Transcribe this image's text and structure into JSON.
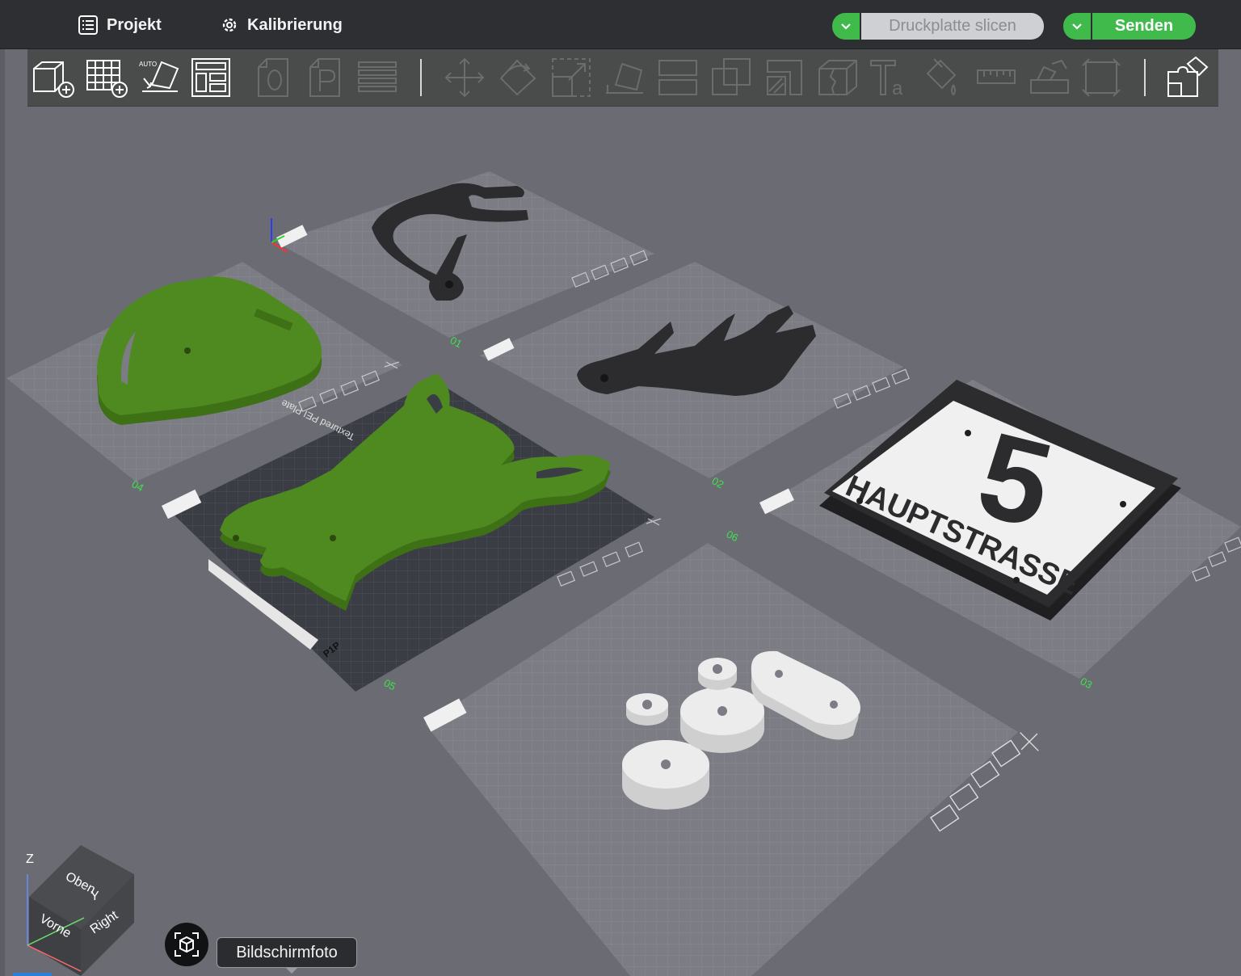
{
  "header": {
    "menu": [
      {
        "label": "Projekt",
        "icon": "list-icon"
      },
      {
        "label": "Kalibrierung",
        "icon": "gear-icon"
      }
    ],
    "slice_button": {
      "label": "Druckplatte slicen",
      "enabled": false
    },
    "send_button": {
      "label": "Senden",
      "enabled": true
    },
    "accent_color": "#3fba4b"
  },
  "toolbar": {
    "tools": [
      {
        "name": "add-part",
        "icon": "cube-plus-icon",
        "enabled": true
      },
      {
        "name": "add-plate",
        "icon": "grid-plus-icon",
        "enabled": true
      },
      {
        "name": "auto-orient",
        "icon": "auto-orient-icon",
        "enabled": true
      },
      {
        "name": "arrange",
        "icon": "arrange-layout-icon",
        "enabled": true
      },
      {
        "name": "orient-o",
        "icon": "o-page-icon",
        "enabled": false
      },
      {
        "name": "plate-p",
        "icon": "p-page-icon",
        "enabled": false
      },
      {
        "name": "layers",
        "icon": "layers-icon",
        "enabled": false
      },
      {
        "name": "move",
        "icon": "move-icon",
        "enabled": false
      },
      {
        "name": "rotate",
        "icon": "rotate-icon",
        "enabled": false
      },
      {
        "name": "scale",
        "icon": "scale-icon",
        "enabled": false
      },
      {
        "name": "lay-on-face",
        "icon": "lay-on-face-icon",
        "enabled": false
      },
      {
        "name": "cut",
        "icon": "cut-icon",
        "enabled": false
      },
      {
        "name": "boolean",
        "icon": "boolean-icon",
        "enabled": false
      },
      {
        "name": "support-paint",
        "icon": "support-paint-icon",
        "enabled": false
      },
      {
        "name": "seam",
        "icon": "seam-icon",
        "enabled": false
      },
      {
        "name": "text",
        "icon": "text-icon",
        "enabled": false
      },
      {
        "name": "color-paint",
        "icon": "paint-bucket-icon",
        "enabled": false
      },
      {
        "name": "measure",
        "icon": "ruler-icon",
        "enabled": false
      },
      {
        "name": "assembly-view",
        "icon": "assembly-icon",
        "enabled": false
      },
      {
        "name": "fit-view",
        "icon": "fit-frame-icon",
        "enabled": false
      },
      {
        "name": "assemble",
        "icon": "puzzle-icon",
        "enabled": true
      }
    ]
  },
  "scene": {
    "plates": [
      {
        "number": "01",
        "part": "antler (black)"
      },
      {
        "number": "02",
        "part": "antler (black)"
      },
      {
        "number": "03",
        "part": "house number sign"
      },
      {
        "number": "04",
        "part": "green shield"
      },
      {
        "number": "05",
        "part": "green deer head",
        "selected": true,
        "plate_label": "Textured PEI Plate",
        "sticker": "P1P"
      },
      {
        "number": "06",
        "part": "white spacers"
      }
    ],
    "sign": {
      "number": "5",
      "street": "HAUPTSTRASSE"
    },
    "colors": {
      "green_part": "#4e8a1f",
      "black_part": "#2c2c2e",
      "white_part": "#ececec"
    }
  },
  "view_cube": {
    "top": "Oben",
    "front": "Vorne",
    "right": "Right",
    "axis_z": "Z",
    "axis_y": "Y"
  },
  "screenshot": {
    "tooltip": "Bildschirmfoto",
    "icon": "screenshot-icon"
  }
}
